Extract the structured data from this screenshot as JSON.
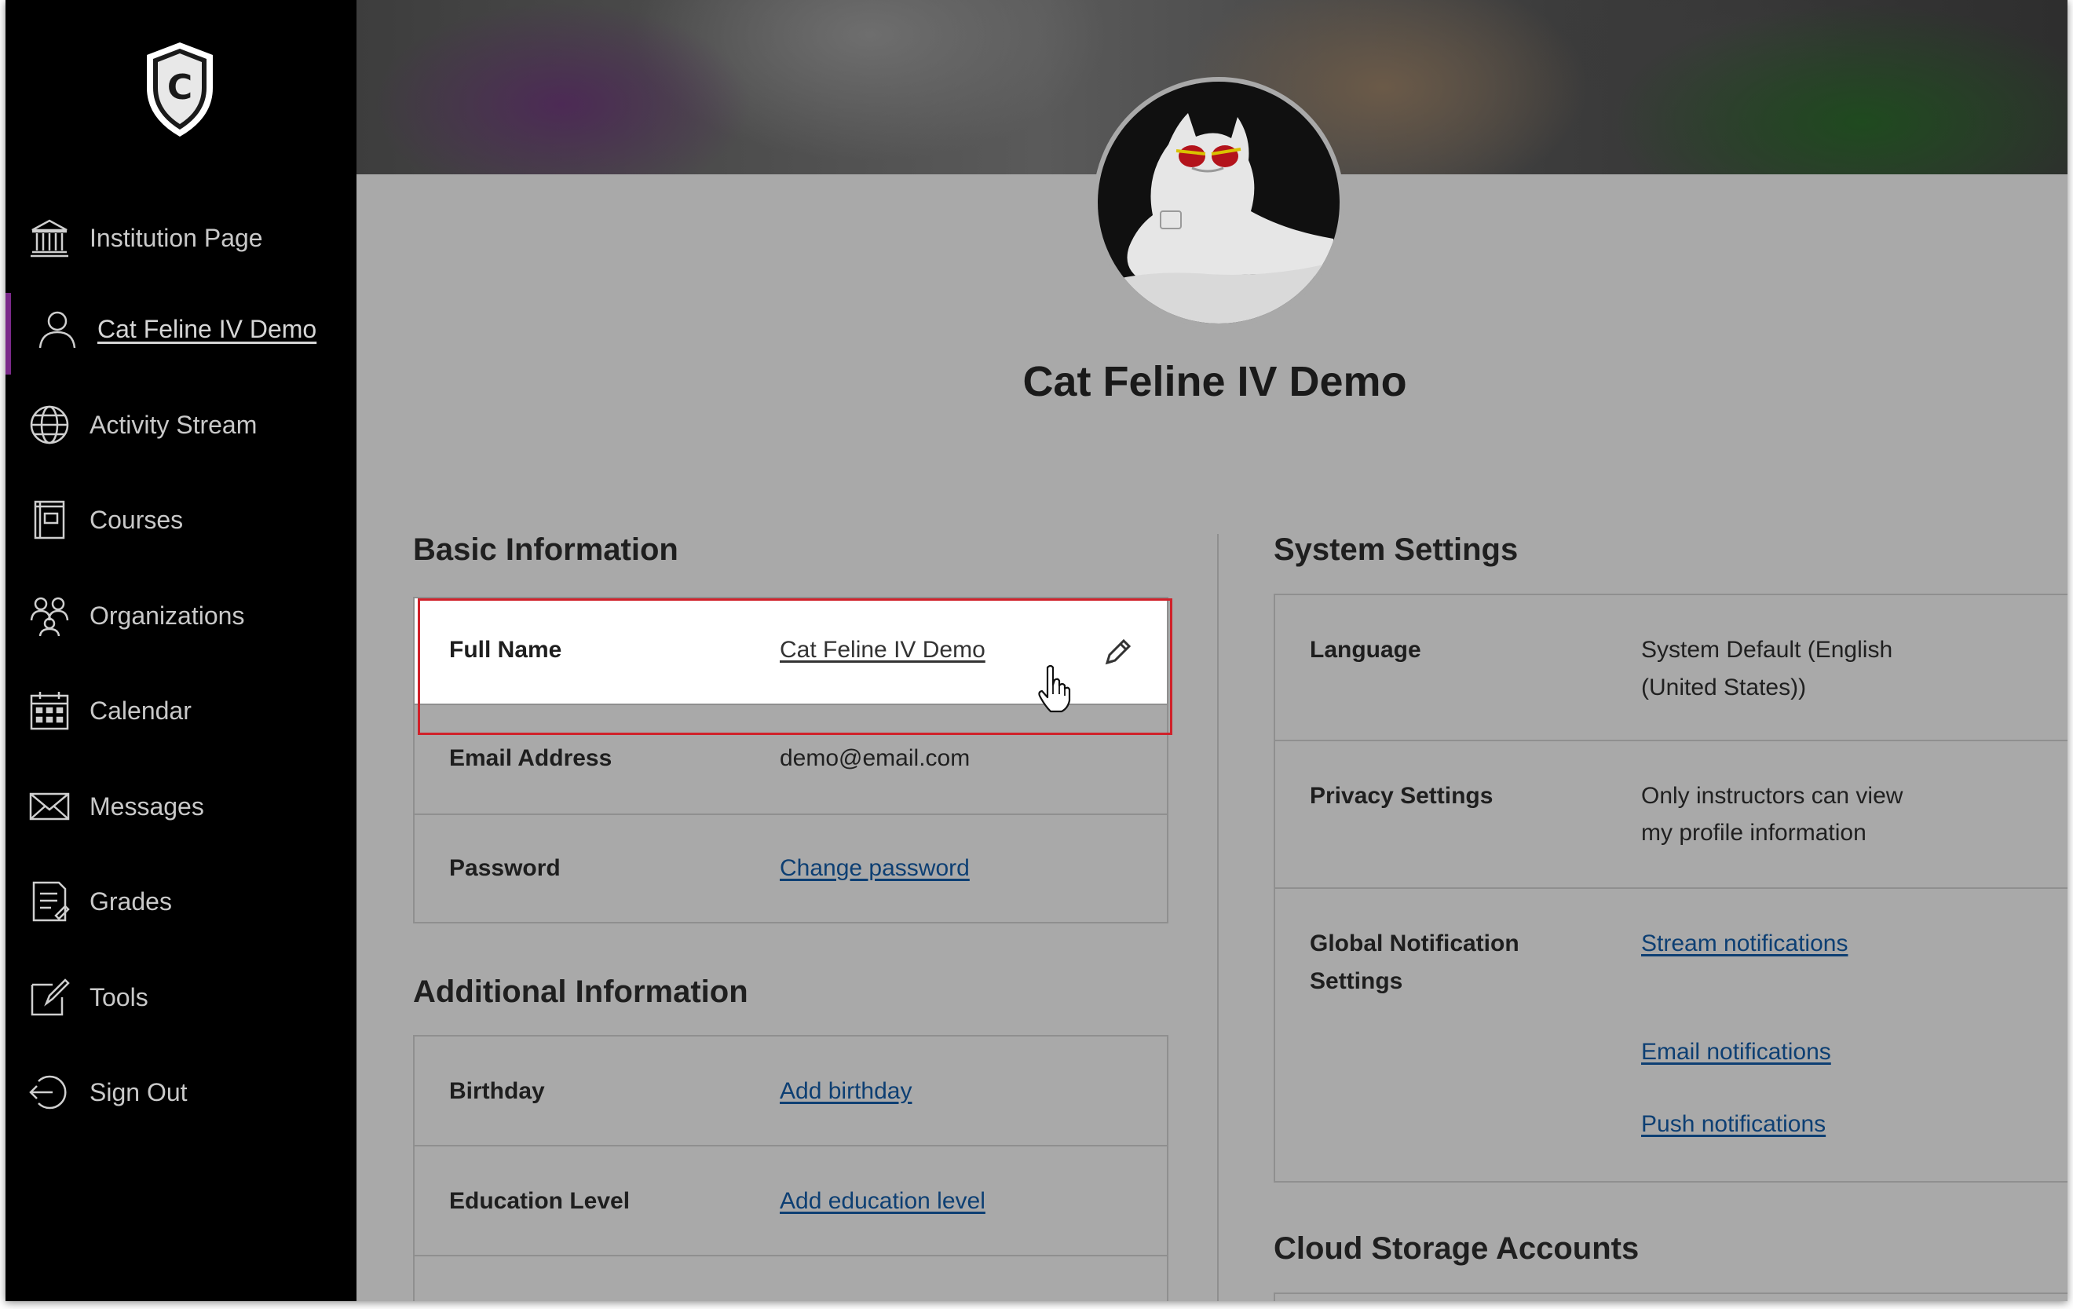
{
  "sidebar": {
    "logo_letter": "C",
    "items": [
      {
        "label": "Institution Page",
        "icon": "institution-icon"
      },
      {
        "label": "Cat Feline IV Demo",
        "icon": "user-icon",
        "active": true
      },
      {
        "label": "Activity Stream",
        "icon": "globe-icon"
      },
      {
        "label": "Courses",
        "icon": "course-icon"
      },
      {
        "label": "Organizations",
        "icon": "organizations-icon"
      },
      {
        "label": "Calendar",
        "icon": "calendar-icon"
      },
      {
        "label": "Messages",
        "icon": "envelope-icon"
      },
      {
        "label": "Grades",
        "icon": "grades-icon"
      },
      {
        "label": "Tools",
        "icon": "tools-icon"
      },
      {
        "label": "Sign Out",
        "icon": "sign-out-icon"
      }
    ]
  },
  "profile": {
    "name": "Cat Feline IV Demo"
  },
  "basic_information": {
    "title": "Basic Information",
    "rows": [
      {
        "label": "Full Name",
        "value": "Cat Feline IV Demo"
      },
      {
        "label": "Email Address",
        "value": "demo@email.com"
      },
      {
        "label": "Password",
        "value": "Change password"
      }
    ]
  },
  "additional_information": {
    "title": "Additional Information",
    "rows": [
      {
        "label": "Birthday",
        "value": "Add birthday"
      },
      {
        "label": "Education Level",
        "value": "Add education level"
      }
    ]
  },
  "system_settings": {
    "title": "System Settings",
    "language_label": "Language",
    "language_value_line1": "System Default (English",
    "language_value_line2": "(United States))",
    "privacy_label": "Privacy Settings",
    "privacy_value_line1": "Only instructors can view",
    "privacy_value_line2": "my profile information",
    "notifications_label_line1": "Global Notification",
    "notifications_label_line2": "Settings",
    "stream_link": "Stream notifications",
    "email_link": "Email notifications",
    "push_link": "Push notifications"
  },
  "cloud_storage": {
    "title": "Cloud Storage Accounts"
  },
  "colors": {
    "sidebar_bg": "#000000",
    "active_indicator": "#7b2a8a",
    "highlight_border": "#d0212a",
    "link": "#0d3f73",
    "overlay_bg": "#a9a9a9"
  }
}
